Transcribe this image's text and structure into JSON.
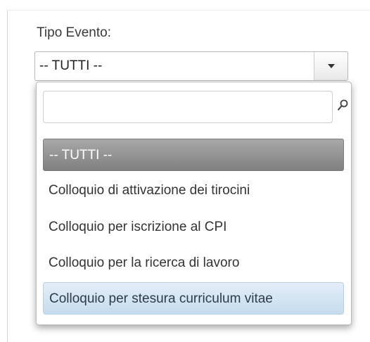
{
  "filter": {
    "label": "Tipo Evento:",
    "selected_value": "-- TUTTI --"
  },
  "dropdown": {
    "search_value": "",
    "search_icon": "search-icon",
    "options": [
      {
        "label": "-- TUTTI --",
        "state": "selected"
      },
      {
        "label": "Colloquio di attivazione dei tirocini",
        "state": "normal"
      },
      {
        "label": "Colloquio per iscrizione al CPI",
        "state": "normal"
      },
      {
        "label": "Colloquio per la ricerca di lavoro",
        "state": "normal"
      },
      {
        "label": "Colloquio per stesura curriculum vitae",
        "state": "hover"
      }
    ]
  },
  "colors": {
    "selected_option": "#8f8f8f",
    "hover_option": "#c5dced"
  }
}
